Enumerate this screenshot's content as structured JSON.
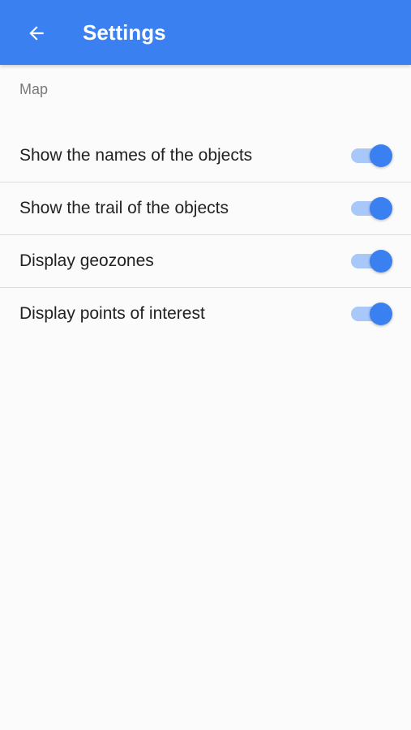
{
  "app_bar": {
    "title": "Settings",
    "back_icon": "arrow-left-icon",
    "background_color": "#3a80f0"
  },
  "section": {
    "header": "Map"
  },
  "settings": [
    {
      "label": "Show the names of the objects",
      "enabled": true
    },
    {
      "label": "Show the trail of the objects",
      "enabled": true
    },
    {
      "label": "Display geozones",
      "enabled": true
    },
    {
      "label": "Display points of interest",
      "enabled": true
    }
  ],
  "colors": {
    "accent": "#3a80f0",
    "switch_track_on": "#a9c8fa",
    "divider": "#dedede",
    "background": "#fbfbfb"
  }
}
